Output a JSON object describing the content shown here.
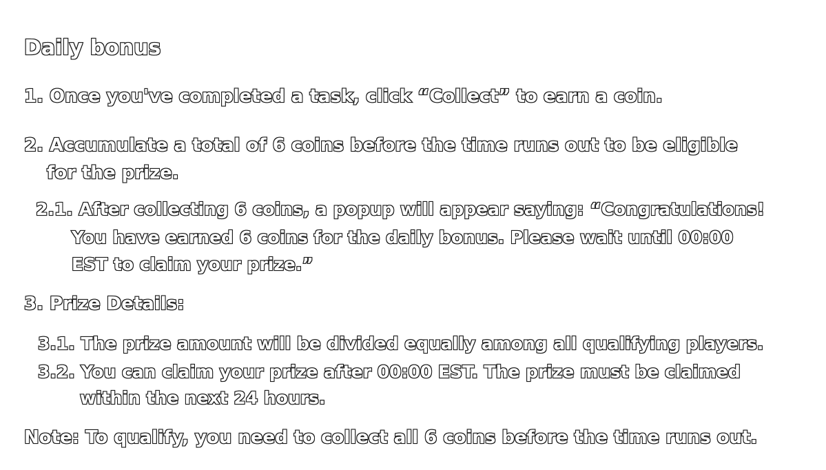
{
  "title": "Daily bonus",
  "items": {
    "step1": "1. Once you've completed a task, click “Collect” to earn a coin.",
    "step2_line1": "2. Accumulate a total of 6 coins before the time runs out to be eligible",
    "step2_line2": "for the prize.",
    "step2_1_line1": "2.1. After collecting 6 coins, a popup will appear saying: “Congratulations!",
    "step2_1_line2": "You have earned 6 coins for the daily bonus. Please wait until 00:00",
    "step2_1_line3": "EST to claim your prize.”",
    "step3": "3. Prize Details:",
    "step3_1": "3.1. The prize amount will be divided equally among all qualifying players.",
    "step3_2_line1": "3.2. You can claim your prize after 00:00 EST. The prize must be claimed",
    "step3_2_line2": "within the next 24 hours.",
    "note": "Note: To qualify, you need to collect all 6 coins before the time runs out."
  }
}
